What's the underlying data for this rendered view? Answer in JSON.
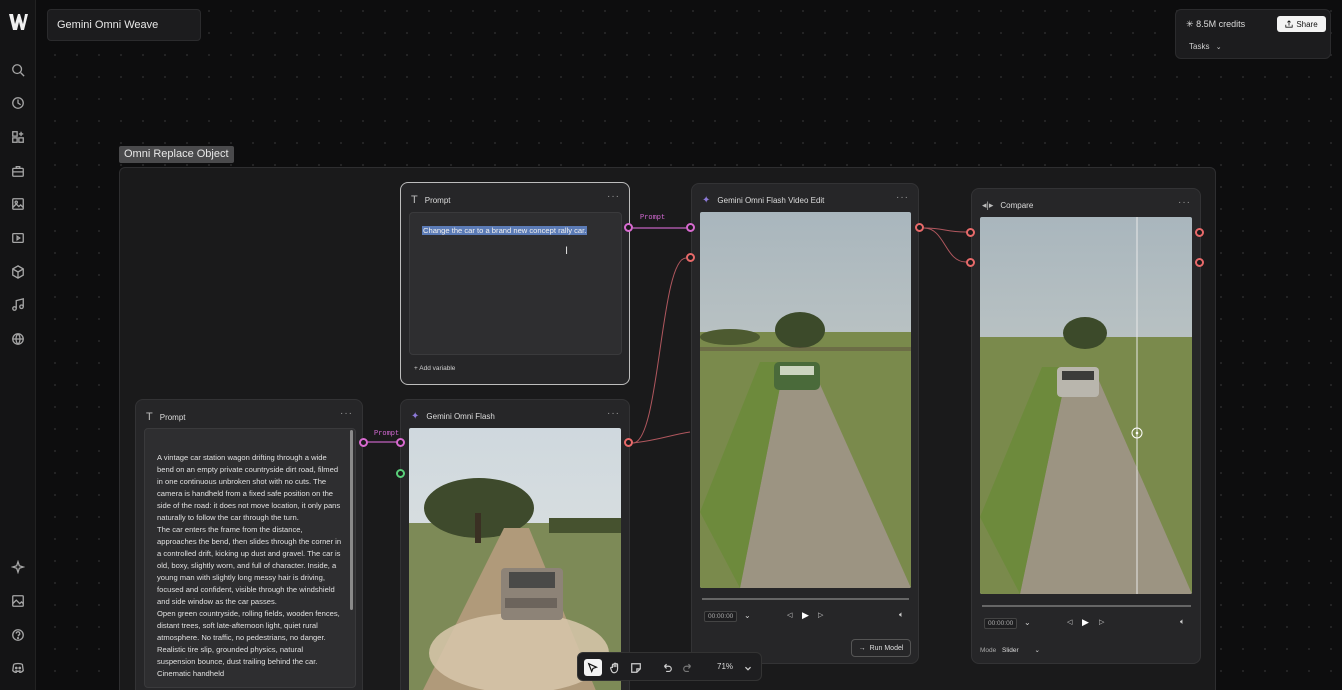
{
  "app": {
    "title": "Gemini Omni Weave",
    "credits": "8.5M credits",
    "share_label": "Share",
    "tasks_label": "Tasks"
  },
  "group": {
    "label": "Omni Replace Object"
  },
  "nodes": {
    "prompt_top": {
      "title": "Prompt",
      "text": "Change the car to a brand new concept rally car.",
      "add_variable": "Add variable"
    },
    "prompt_left": {
      "title": "Prompt",
      "text": "A vintage car station wagon drifting through a wide bend on an empty private countryside dirt road, filmed in one continuous unbroken shot with no cuts. The camera is handheld from a fixed safe position on the side of the road: it does not move location, it only pans naturally to follow the car through the turn.\nThe car enters the frame from the distance, approaches the bend, then slides through the corner in a controlled drift, kicking up dust and gravel. The car is old, boxy, slightly worn, and full of character. Inside, a young man with slightly long messy hair is driving, focused and confident, visible through the windshield and side window as the car passes.\nOpen green countryside, rolling fields, wooden fences, distant trees, soft late-afternoon light, quiet rural atmosphere. No traffic, no pedestrians, no danger. Realistic tire slip, grounded physics, natural suspension bounce, dust trailing behind the car. Cinematic handheld"
    },
    "flash": {
      "title": "Gemini Omni Flash"
    },
    "video_edit": {
      "title": "Gemini Omni Flash Video Edit",
      "timecode": "00:00:00",
      "run_label": "Run Model"
    },
    "compare": {
      "title": "Compare",
      "timecode": "00:00:00",
      "mode_label": "Mode",
      "mode_value": "Slider"
    }
  },
  "edge_labels": {
    "prompt_a": "Prompt",
    "prompt_b": "Prompt"
  },
  "toolbar": {
    "zoom": "71%"
  },
  "colors": {
    "port_pink": "#d86ad0",
    "port_red": "#e86a6a",
    "port_green": "#5ad07a",
    "selection": "#5b7bb6"
  },
  "icons": [
    "search-icon",
    "history-icon",
    "apps-icon",
    "briefcase-icon",
    "image-icon",
    "video-icon",
    "cube-icon",
    "music-icon",
    "globe-icon",
    "sparkle-icon",
    "gallery-icon",
    "help-icon",
    "discord-icon"
  ]
}
